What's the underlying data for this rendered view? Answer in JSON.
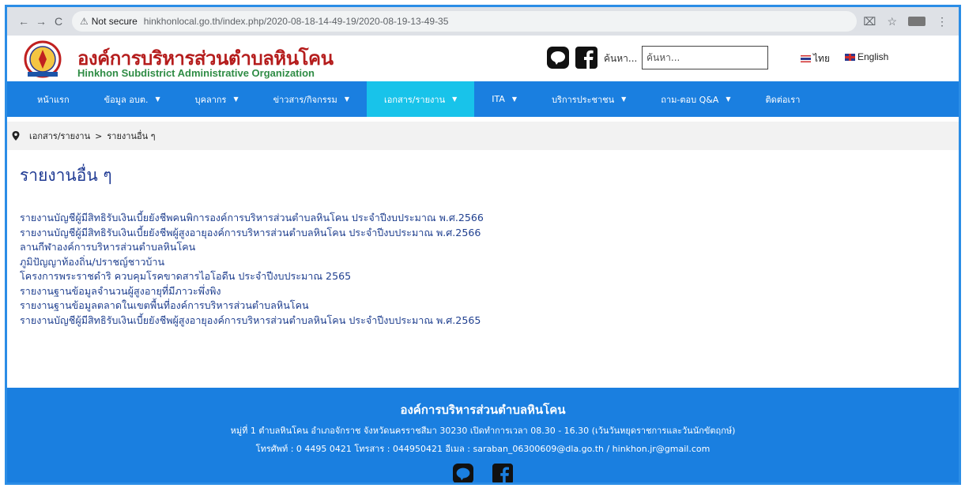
{
  "browser": {
    "back_icon": "arrow-left-icon",
    "forward_icon": "arrow-right-icon",
    "reload_icon": "reload-icon",
    "security_label": "Not secure",
    "url": "hinkhonlocal.go.th/index.php/2020-08-18-14-49-19/2020-08-19-13-49-35"
  },
  "header": {
    "title_th": "องค์การบริหารส่วนตำบลหินโคน",
    "title_en": "Hinkhon Subdistrict Administrative Organization",
    "search_label": "ค้นหา...",
    "search_placeholder": "ค้นหา...",
    "lang_th": "ไทย",
    "lang_en": "English"
  },
  "nav": {
    "items": [
      {
        "label": "หน้าแรก",
        "caret": false
      },
      {
        "label": "ข้อมูล อบต.",
        "caret": true
      },
      {
        "label": "บุคลากร",
        "caret": true
      },
      {
        "label": "ข่าวสาร/กิจกรรม",
        "caret": true
      },
      {
        "label": "เอกสาร/รายงาน",
        "caret": true,
        "active": true
      },
      {
        "label": "ITA",
        "caret": true
      },
      {
        "label": "บริการประชาชน",
        "caret": true
      },
      {
        "label": "ถาม-ตอบ Q&A",
        "caret": true
      },
      {
        "label": "ติดต่อเรา",
        "caret": false
      }
    ]
  },
  "breadcrumb": {
    "parent": "เอกสาร/รายงาน",
    "separator": ">",
    "current": "รายงานอื่น ๆ"
  },
  "page": {
    "heading": "รายงานอื่น ๆ",
    "links": [
      "รายงานบัญชีผู้มีสิทธิรับเงินเบี้ยยังชีพคนพิการองค์การบริหารส่วนตำบลหินโคน ประจำปีงบประมาณ พ.ศ.2566",
      "รายงานบัญชีผู้มีสิทธิรับเงินเบี้ยยังชีพผู้สูงอายุองค์การบริหารส่วนตำบลหินโคน ประจำปีงบประมาณ พ.ศ.2566",
      "ลานกีฬาองค์การบริหารส่วนตำบลหินโคน",
      "ภูมิปัญญาท้องถิ่น/ปราชญ์ชาวบ้าน",
      "โครงการพระราชดำริ ควบคุมโรคขาดสารไอโอดีน ประจำปีงบประมาณ 2565",
      "รายงานฐานข้อมูลจำนวนผู้สูงอายุที่มีภาวะพึ่งพิง",
      "รายงานฐานข้อมูลตลาดในเขตพื้นที่องค์การบริหารส่วนตำบลหินโคน",
      "รายงานบัญชีผู้มีสิทธิรับเงินเบี้ยยังชีพผู้สูงอายุองค์การบริหารส่วนตำบลหินโคน ประจำปีงบประมาณ พ.ศ.2565"
    ]
  },
  "footer": {
    "title": "องค์การบริหารส่วนตำบลหินโคน",
    "address": "หมู่ที่ 1 ตำบลหินโคน อำเภอจักราช จังหวัดนครราชสีมา 30230 เปิดทำการเวลา 08.30 - 16.30 (เว้นวันหยุดราชการและวันนักขัตฤกษ์)",
    "contact": "โทรศัพท์ : 0 4495 0421 โทรสาร : 044950421 อีเมล : saraban_06300609@dla.go.th / hinkhon.jr@gmail.com"
  },
  "colors": {
    "nav_bg": "#1a7fe0",
    "nav_active": "#18c3ea",
    "title_red": "#b51d1d",
    "title_green": "#2f8c45",
    "link": "#1f3f8f"
  }
}
